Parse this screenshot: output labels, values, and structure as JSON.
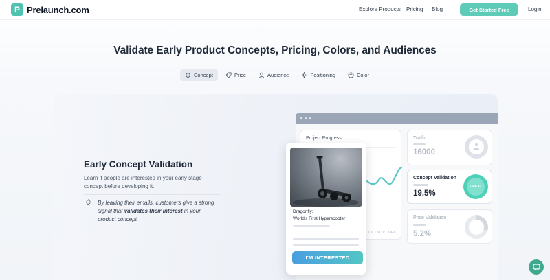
{
  "nav": {
    "logo_letter": "P",
    "logo_text": "Prelaunch.com",
    "links": [
      "Explore Products",
      "Pricing",
      "Blog"
    ],
    "cta_label": "Get Started Free",
    "login_label": "Login"
  },
  "hero": {
    "headline": "Validate Early Product Concepts, Pricing, Colors, and Audiences",
    "tabs": [
      {
        "label": "Concept",
        "icon": "gear-icon",
        "active": true
      },
      {
        "label": "Price",
        "icon": "tag-icon",
        "active": false
      },
      {
        "label": "Audience",
        "icon": "user-icon",
        "active": false
      },
      {
        "label": "Positioning",
        "icon": "sparkle-icon",
        "active": false
      },
      {
        "label": "Color",
        "icon": "palette-icon",
        "active": false
      }
    ]
  },
  "feature": {
    "title": "Early Concept Validation",
    "description": "Learn if people are interested in your early stage concept before developing it.",
    "tip_before": "By leaving their emails, customers give a strong signal that ",
    "tip_bold": "validates their interest",
    "tip_after": " in your product concept."
  },
  "dashboard": {
    "project_progress_label": "Project Progress",
    "months": [
      "OCT",
      "NOV",
      "DEC"
    ],
    "traffic": {
      "label": "Traffic",
      "value": "16000"
    },
    "concept_validation": {
      "label": "Concept Validation",
      "value": "19.5%",
      "badge": "GREAT"
    },
    "price_validation": {
      "label": "Price Validation",
      "value": "5.2%"
    }
  },
  "product": {
    "name_line1": "Dragonfly:",
    "name_line2": "World's First Hyperscooter",
    "cta_label": "I'M INTERESTED"
  },
  "colors": {
    "brand": "#5dcbb7",
    "cta_start": "#4a9ee0",
    "cta_end": "#53c6c4",
    "chat": "#3ea98f"
  }
}
